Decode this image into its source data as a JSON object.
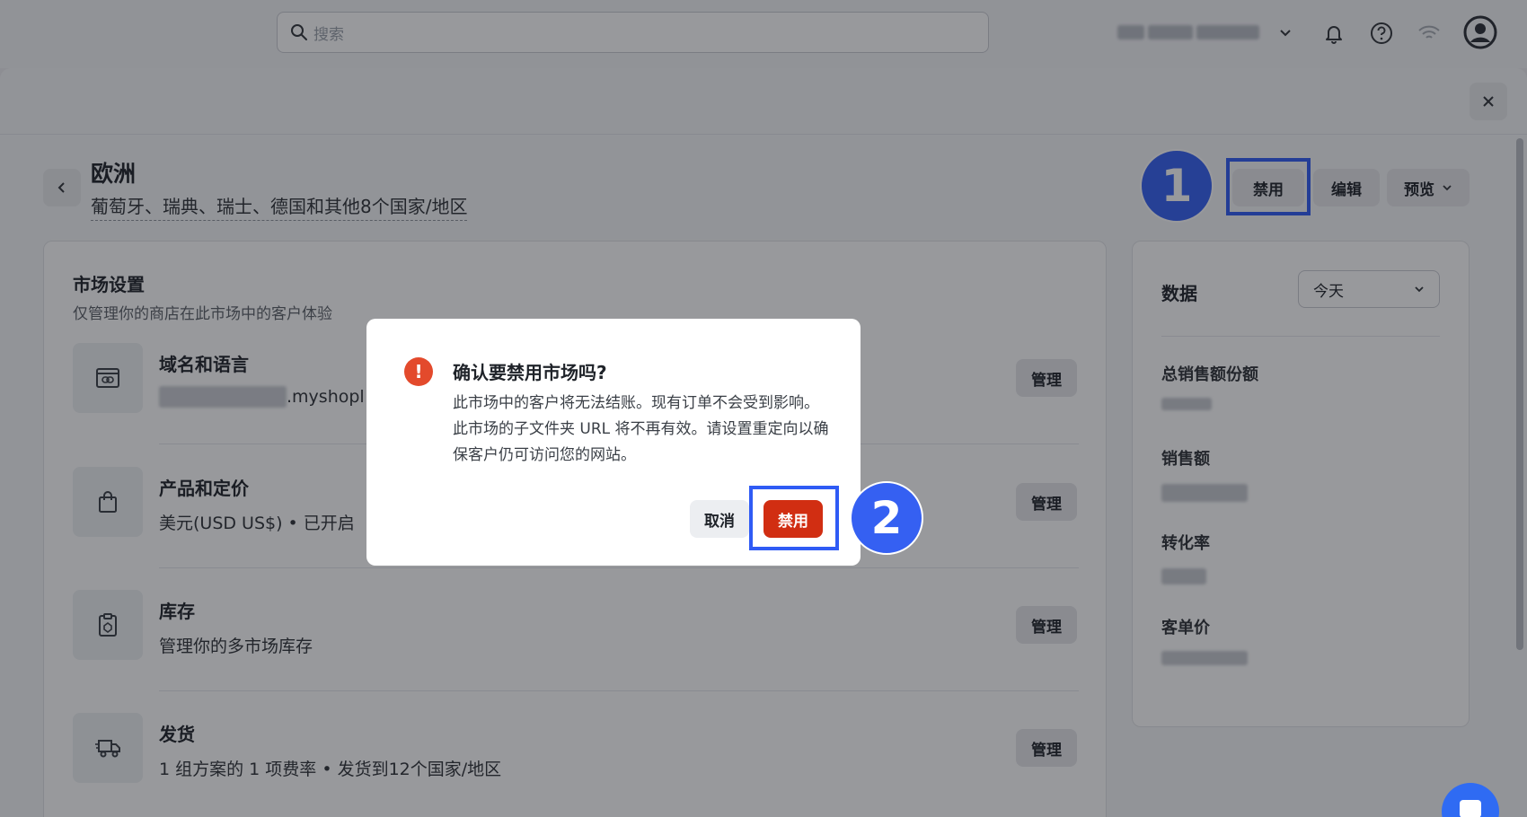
{
  "topbar": {
    "search_placeholder": "搜索"
  },
  "header": {
    "back_label": "",
    "title": "欧洲",
    "subtitle": "葡萄牙、瑞典、瑞士、德国和其他8个国家/地区",
    "disable_label": "禁用",
    "edit_label": "编辑",
    "preview_label": "预览"
  },
  "settings": {
    "title": "市场设置",
    "subtitle": "仅管理你的商店在此市场中的客户体验",
    "items": [
      {
        "title": "域名和语言",
        "desc": ".myshopl",
        "icon": "link-icon",
        "button": "管理"
      },
      {
        "title": "产品和定价",
        "desc": "美元(USD US$) • 已开启",
        "icon": "shopping-bag-icon",
        "button": "管理"
      },
      {
        "title": "库存",
        "desc": "管理你的多市场库存",
        "icon": "inventory-icon",
        "button": "管理"
      },
      {
        "title": "发货",
        "desc": "1 组方案的 1 项费率 • 发货到12个国家/地区",
        "icon": "truck-icon",
        "button": "管理"
      }
    ]
  },
  "data_panel": {
    "title": "数据",
    "period": "今天",
    "metrics": [
      "总销售额份额",
      "销售额",
      "转化率",
      "客单价"
    ]
  },
  "modal": {
    "title": "确认要禁用市场吗?",
    "body": "此市场中的客户将无法结账。现有订单不会受到影响。此市场的子文件夹 URL 将不再有效。请设置重定向以确保客户仍可访问您的网站。",
    "cancel_label": "取消",
    "confirm_label": "禁用"
  },
  "annotations": {
    "step1": "1",
    "step2": "2"
  },
  "colors": {
    "accent": "#2f5bf5",
    "danger": "#d12e12"
  }
}
